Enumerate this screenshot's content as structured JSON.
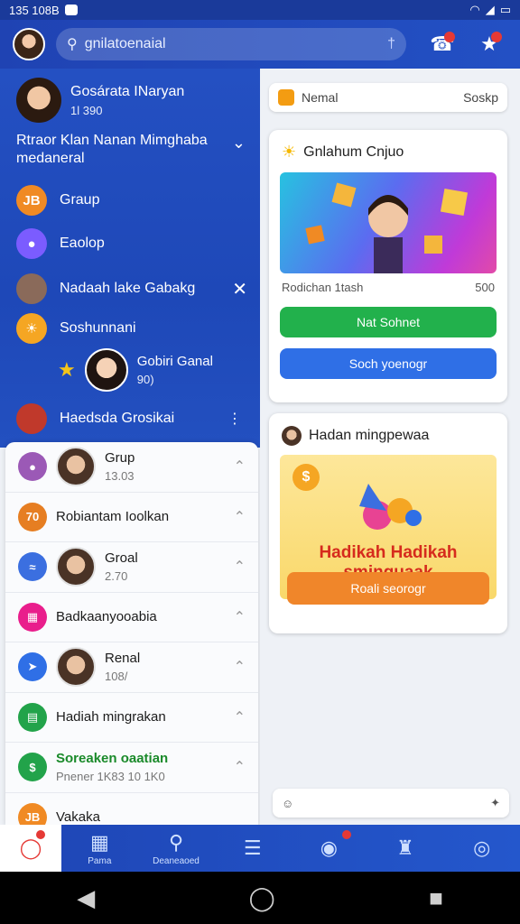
{
  "status_bar": {
    "time": "135 108B"
  },
  "header": {
    "search_text": "gnilatoenaial",
    "icons": [
      "chat-bubble-icon",
      "friend-request-icon"
    ]
  },
  "left_panel": {
    "profile": {
      "name": "Gosárata INaryan",
      "sub": "1l 390"
    },
    "headline": "Rtraor Klan Nanan Mimghaba medaneral",
    "nav_items": [
      {
        "label": "Graup",
        "icon": "group-icon",
        "color": "#f08a24"
      },
      {
        "label": "Eaolop",
        "icon": "game-icon",
        "color": "#7b5cff"
      },
      {
        "label": "Nadaah lake Gabakg",
        "icon": "avatar-icon",
        "color": "#8a6a5a"
      },
      {
        "label": "Soshunnani",
        "icon": "sun-icon",
        "color": "#f5a623"
      },
      {
        "label": "Haedsda Grosikai",
        "icon": "avatar-icon",
        "color": "#c0392b"
      }
    ],
    "story": {
      "name": "Gobiri Ganal",
      "sub": "90)"
    }
  },
  "chat_list": [
    {
      "title": "Grup",
      "sub": "13.03",
      "type": "face",
      "icon_color": "#9b59b6"
    },
    {
      "title": "Robiantam Ioolkan",
      "sub": "",
      "type": "icon",
      "icon_color": "#e67e22"
    },
    {
      "title": "Groal",
      "sub": "2.70",
      "type": "face",
      "icon_color": "#3b6fe0"
    },
    {
      "title": "Badkaanyooabia",
      "sub": "",
      "type": "icon",
      "icon_color": "#e91e8c"
    },
    {
      "title": "Renal",
      "sub": "108/",
      "type": "face",
      "icon_color": "#2f6fe6"
    },
    {
      "title": "Hadiah mingrakan",
      "sub": "",
      "type": "icon",
      "icon_color": "#22a34a"
    },
    {
      "title": "Soreaken oaatian",
      "sub": "Pnener 1K83 10 1K0",
      "type": "icon",
      "icon_color": "#22a34a",
      "green": true
    },
    {
      "title": "Vakaka",
      "sub": "",
      "type": "icon",
      "icon_color": "#f08a24"
    }
  ],
  "right_panel": {
    "top_bar": {
      "left": "Nemal",
      "right": "Soskp"
    },
    "card1": {
      "title": "Gnlahum Cnjuo",
      "meta_left": "Rodichan 1tash",
      "meta_right": "500",
      "btn_primary": "Nat Sohnet",
      "btn_secondary": "Soch yoenogr"
    },
    "card2": {
      "title": "Hadan mingpewaa",
      "promo_text": "Hadikah Hadikah sminguaak",
      "promo_btn": "Roali seorogr"
    },
    "compose": {
      "placeholder": ""
    }
  },
  "bottom_nav": [
    {
      "label": "",
      "icon": "chat-icon",
      "active": true,
      "badge": true
    },
    {
      "label": "Pama",
      "icon": "news-icon",
      "active": false,
      "badge": false
    },
    {
      "label": "Deaneaoed",
      "icon": "search-icon",
      "active": false,
      "badge": false
    },
    {
      "label": "",
      "icon": "list-icon",
      "active": false,
      "badge": false
    },
    {
      "label": "",
      "icon": "notification-icon",
      "active": false,
      "badge": true
    },
    {
      "label": "",
      "icon": "people-icon",
      "active": false,
      "badge": false
    },
    {
      "label": "",
      "icon": "support-icon",
      "active": false,
      "badge": false
    }
  ],
  "system_nav": [
    "back-icon",
    "home-icon",
    "recents-icon"
  ],
  "colors": {
    "primary": "#2350c4",
    "accent_green": "#22b14c",
    "accent_orange": "#f0862a",
    "alert_red": "#e53935"
  }
}
